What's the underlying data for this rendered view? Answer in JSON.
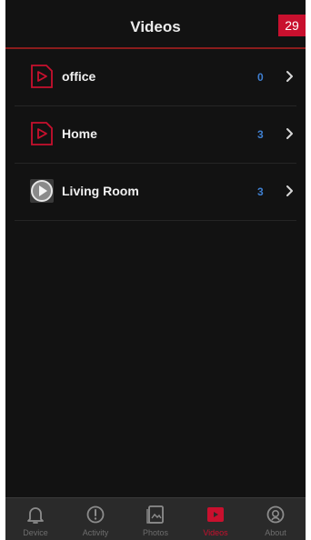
{
  "header": {
    "title": "Videos",
    "page_badge": "29"
  },
  "cameras": [
    {
      "name": "office",
      "count": "0",
      "icon": "play-outline-icon"
    },
    {
      "name": "Home",
      "count": "3",
      "icon": "play-outline-icon"
    },
    {
      "name": "Living Room",
      "count": "3",
      "icon": "play-thumbnail-icon"
    }
  ],
  "tabs": [
    {
      "label": "Device",
      "icon": "bell-icon",
      "active": false
    },
    {
      "label": "Activity",
      "icon": "alert-icon",
      "active": false
    },
    {
      "label": "Photos",
      "icon": "photos-icon",
      "active": false
    },
    {
      "label": "Videos",
      "icon": "video-icon",
      "active": true
    },
    {
      "label": "About",
      "icon": "info-icon",
      "active": false
    }
  ],
  "colors": {
    "accent": "#c8102e",
    "count": "#3f7fd0",
    "background": "#121212",
    "tabbar": "#2a2a2a"
  }
}
